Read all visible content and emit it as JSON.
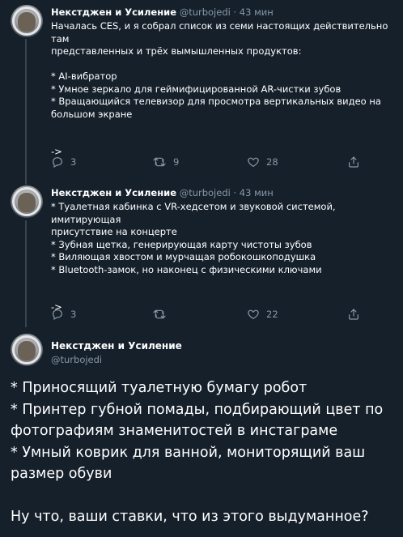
{
  "tweets": [
    {
      "author": "Некстджен и Усиление",
      "handle": "@turbojedi",
      "separator": "·",
      "time": "43 мин",
      "lines": [
        "Началась CES, и я собрал список из семи настоящих действительно там",
        "представленных и трёх вымышленных продуктов:",
        "",
        "* AI-вибратор",
        "* Умное зеркало для геймифицированной AR-чистки зубов",
        "* Вращающийся телевизор для просмотра вертикальных видео на",
        "большом экране",
        "",
        "->"
      ],
      "replies": "3",
      "retweets": "9",
      "likes": "28"
    },
    {
      "author": "Некстджен и Усиление",
      "handle": "@turbojedi",
      "separator": "·",
      "time": "43 мин",
      "lines": [
        "* Туалетная кабинка с VR-хедсетом и звуковой системой, имитирующая",
        "присутствие на концерте",
        "* Зубная щетка, генерирующая карту чистоты зубов",
        "* Виляющая хвостом и мурчащая робокошкоподушка",
        "* Bluetooth-замок, но наконец с физическими ключами",
        "",
        "->"
      ],
      "replies": "3",
      "retweets": "",
      "likes": "22"
    }
  ],
  "main_tweet": {
    "author": "Некстджен и Усиление",
    "handle": "@turbojedi",
    "lines": [
      "* Приносящий туалетную бумагу робот",
      "* Принтер губной помады, подбирающий цвет по",
      "фотографиям знаменитостей в инстаграме",
      "* Умный коврик для ванной, мониторящий ваш",
      "размер обуви",
      "",
      "Ну что, ваши ставки, что из этого выдуманное?"
    ]
  },
  "icons": {
    "reply": "reply-icon",
    "retweet": "retweet-icon",
    "like": "heart-icon",
    "share": "share-icon"
  },
  "colors": {
    "background": "#15202b",
    "text": "#ffffff",
    "secondary": "#8899a6",
    "thread_line": "#38444d"
  }
}
